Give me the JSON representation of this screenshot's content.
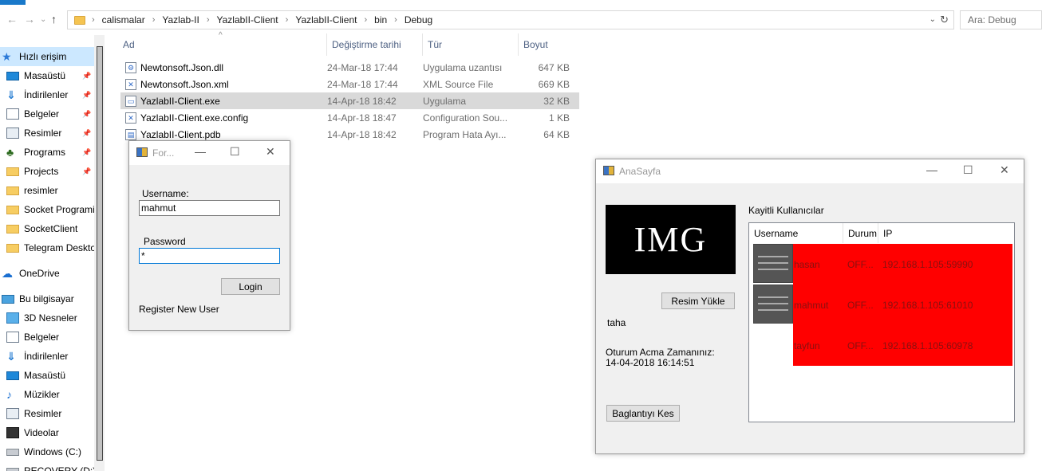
{
  "explorer": {
    "breadcrumbs": [
      "calismalar",
      "Yazlab-II",
      "YazlabII-Client",
      "YazlabII-Client",
      "bin",
      "Debug"
    ],
    "search_placeholder": "Ara: Debug",
    "columns": {
      "name": "Ad",
      "date": "Değiştirme tarihi",
      "type": "Tür",
      "size": "Boyut"
    },
    "files": [
      {
        "name": "Newtonsoft.Json.dll",
        "date": "24-Mar-18 17:44",
        "type": "Uygulama uzantısı",
        "size": "647 KB",
        "icon": "dll-file-icon"
      },
      {
        "name": "Newtonsoft.Json.xml",
        "date": "24-Mar-18 17:44",
        "type": "XML Source File",
        "size": "669 KB",
        "icon": "xml-file-icon"
      },
      {
        "name": "YazlabII-Client.exe",
        "date": "14-Apr-18 18:42",
        "type": "Uygulama",
        "size": "32 KB",
        "icon": "exe-file-icon"
      },
      {
        "name": "YazlabII-Client.exe.config",
        "date": "14-Apr-18 18:47",
        "type": "Configuration Sou...",
        "size": "1 KB",
        "icon": "config-file-icon"
      },
      {
        "name": "YazlabII-Client.pdb",
        "date": "14-Apr-18 18:42",
        "type": "Program Hata Ayı...",
        "size": "64 KB",
        "icon": "pdb-file-icon"
      }
    ],
    "selected_file_index": 2,
    "nav": [
      {
        "label": "Hızlı erişim",
        "icon": "star-icon",
        "pinned": false,
        "selected": true,
        "top": true
      },
      {
        "label": "Masaüstü",
        "icon": "desktop-icon",
        "pinned": true
      },
      {
        "label": "İndirilenler",
        "icon": "download-icon",
        "pinned": true
      },
      {
        "label": "Belgeler",
        "icon": "documents-icon",
        "pinned": true
      },
      {
        "label": "Resimler",
        "icon": "pictures-icon",
        "pinned": true
      },
      {
        "label": "Programs",
        "icon": "tree-icon",
        "pinned": true
      },
      {
        "label": "Projects",
        "icon": "folder-icon",
        "pinned": true
      },
      {
        "label": "resimler",
        "icon": "folder-icon",
        "pinned": false
      },
      {
        "label": "Socket Programi",
        "icon": "folder-icon",
        "pinned": false
      },
      {
        "label": "SocketClient",
        "icon": "folder-icon",
        "pinned": false
      },
      {
        "label": "Telegram Deskto",
        "icon": "folder-icon",
        "pinned": false
      },
      {
        "label": "OneDrive",
        "icon": "cloud-icon",
        "pinned": false,
        "top": true
      },
      {
        "label": "Bu bilgisayar",
        "icon": "computer-icon",
        "pinned": false,
        "top": true
      },
      {
        "label": "3D Nesneler",
        "icon": "3d-objects-icon",
        "pinned": false
      },
      {
        "label": "Belgeler",
        "icon": "documents-icon",
        "pinned": false
      },
      {
        "label": "İndirilenler",
        "icon": "download-icon",
        "pinned": false
      },
      {
        "label": "Masaüstü",
        "icon": "desktop-icon",
        "pinned": false
      },
      {
        "label": "Müzikler",
        "icon": "music-icon",
        "pinned": false
      },
      {
        "label": "Resimler",
        "icon": "pictures-icon",
        "pinned": false
      },
      {
        "label": "Videolar",
        "icon": "video-icon",
        "pinned": false
      },
      {
        "label": "Windows (C:)",
        "icon": "drive-icon",
        "pinned": false
      },
      {
        "label": "RECOVERY (D:)",
        "icon": "drive-icon",
        "pinned": false
      }
    ]
  },
  "login_window": {
    "title": "For...",
    "username_label": "Username:",
    "username_value": "mahmut",
    "password_label": "Password",
    "password_value": "*",
    "login_button": "Login",
    "register_link": "Register New User"
  },
  "main_window": {
    "title": "AnaSayfa",
    "image_text": "IMG",
    "upload_button": "Resim Yükle",
    "current_user": "taha",
    "session_label": "Oturum Acma Zamanınız:",
    "session_time": "14-04-2018 16:14:51",
    "disconnect_button": "Baglantıyı Kes",
    "users_label": "Kayitli Kullanıcılar",
    "columns": {
      "username": "Username",
      "status": "Durum",
      "ip": "IP"
    },
    "users": [
      {
        "username": "hasan",
        "status": "OFF...",
        "ip": "192.168.1.105:59990",
        "has_thumb": true
      },
      {
        "username": "mahmut",
        "status": "OFF...",
        "ip": "192.168.1.105:61010",
        "has_thumb": true
      },
      {
        "username": "tayfun",
        "status": "OFF...",
        "ip": "192.168.1.105:60978",
        "has_thumb": false
      }
    ],
    "row_color": "#ff0000"
  }
}
